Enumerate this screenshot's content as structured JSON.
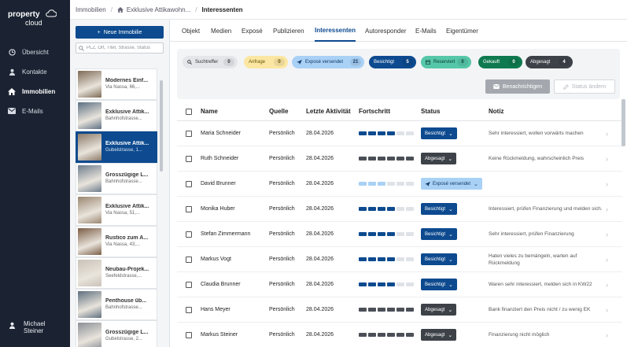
{
  "brand": {
    "line1": "property",
    "line2": "cloud"
  },
  "nav": {
    "items": [
      {
        "label": "Übersicht",
        "icon": "clock-icon"
      },
      {
        "label": "Kontakte",
        "icon": "person-icon"
      },
      {
        "label": "Immobilien",
        "icon": "house-icon"
      },
      {
        "label": "E-Mails",
        "icon": "envelope-icon"
      }
    ],
    "user": {
      "first": "Michael",
      "last": "Steiner",
      "icon": "person-icon"
    }
  },
  "breadcrumb": {
    "root": "Immobilien",
    "property": "Exklusive Attikawohn...",
    "current": "Interessenten"
  },
  "sidebar": {
    "new_button": "Neue Immobilie",
    "search_placeholder": "PLZ, Ort, Titel, Strasse, Status",
    "properties": [
      {
        "title": "Modernes Einf...",
        "address": "Via Nassa, 66,..."
      },
      {
        "title": "Exklusive Attik...",
        "address": "Bahnhofstrasse..."
      },
      {
        "title": "Exklusive Attik...",
        "address": "Gubelstrasse, 1..."
      },
      {
        "title": "Grosszügige L...",
        "address": "Bahnhofstrasse..."
      },
      {
        "title": "Exklusive Attik...",
        "address": "Via Nassa, 51,..."
      },
      {
        "title": "Rustico zum A...",
        "address": "Via Nassa, 43,..."
      },
      {
        "title": "Neubau-Projek...",
        "address": "Seefeldstrasse,..."
      },
      {
        "title": "Penthouse üb...",
        "address": "Bahnhofstrasse..."
      },
      {
        "title": "Grosszügige L...",
        "address": "Gubelstrasse, 2..."
      }
    ]
  },
  "tabs": [
    "Objekt",
    "Medien",
    "Exposé",
    "Publizieren",
    "Interessenten",
    "Autoresponder",
    "E-Mails",
    "Eigentümer"
  ],
  "filters": [
    {
      "label": "Suchtreffer",
      "count": "0",
      "bg": "#e4e6ea",
      "fg": "#333",
      "icon": "search-icon"
    },
    {
      "label": "Anfrage",
      "count": "0",
      "bg": "#fbe7a3",
      "fg": "#6b5200",
      "icon": ""
    },
    {
      "label": "Exposé versendet",
      "count": "21",
      "bg": "#a9d1f5",
      "fg": "#103a66",
      "icon": "send-icon"
    },
    {
      "label": "Besichtigt",
      "count": "5",
      "bg": "#0d4a8f",
      "fg": "#ffffff",
      "icon": ""
    },
    {
      "label": "Reserviert",
      "count": "0",
      "bg": "#56c7a9",
      "fg": "#0b3b2e",
      "icon": "calendar-icon"
    },
    {
      "label": "Gekauft",
      "count": "0",
      "bg": "#0f7a4f",
      "fg": "#ffffff",
      "icon": ""
    },
    {
      "label": "Abgesagt",
      "count": "4",
      "bg": "#3d4248",
      "fg": "#ffffff",
      "icon": ""
    }
  ],
  "actions": {
    "notify": "Benachrichtigen",
    "change_status": "Status ändern"
  },
  "columns": {
    "name": "Name",
    "source": "Quelle",
    "activity": "Letzte Aktivität",
    "progress": "Fortschritt",
    "status": "Status",
    "note": "Notiz"
  },
  "colors": {
    "besichtigt": "#0d4a8f",
    "abgesagt": "#3d4248",
    "versendet": "#a9d1f5"
  },
  "rows": [
    {
      "name": "Maria Schneider",
      "source": "Persönlich",
      "activity": "28.04.2026",
      "progress": 4,
      "progress_color": "#0d4a8f",
      "status": "Besichtigt",
      "status_type": "besichtigt",
      "note": "Sehr interessiert, wollen vorwärts machen"
    },
    {
      "name": "Ruth Schneider",
      "source": "Persönlich",
      "activity": "28.04.2026",
      "progress": 6,
      "progress_color": "#4b5058",
      "status": "Abgesagt",
      "status_type": "abgesagt",
      "note": "Keine Rückmeldung, wahrscheinlich Preis"
    },
    {
      "name": "David Brunner",
      "source": "Persönlich",
      "activity": "28.04.2026",
      "progress": 3,
      "progress_color": "#a9d1f5",
      "status": "Exposé versendet",
      "status_type": "versendet",
      "note": ""
    },
    {
      "name": "Monika Huber",
      "source": "Persönlich",
      "activity": "28.04.2026",
      "progress": 4,
      "progress_color": "#0d4a8f",
      "status": "Besichtigt",
      "status_type": "besichtigt",
      "note": "Interessiert, prüfen Finanzierung und melden sich."
    },
    {
      "name": "Stefan Zimmermann",
      "source": "Persönlich",
      "activity": "28.04.2026",
      "progress": 4,
      "progress_color": "#0d4a8f",
      "status": "Besichtigt",
      "status_type": "besichtigt",
      "note": "Sehr interessiert, prüfen Finanzierung"
    },
    {
      "name": "Markus Vogt",
      "source": "Persönlich",
      "activity": "28.04.2026",
      "progress": 4,
      "progress_color": "#0d4a8f",
      "status": "Besichtigt",
      "status_type": "besichtigt",
      "note": "Haten vieles zu bemängeln, warten auf Rückmeldung"
    },
    {
      "name": "Claudia Brunner",
      "source": "Persönlich",
      "activity": "28.04.2026",
      "progress": 4,
      "progress_color": "#0d4a8f",
      "status": "Besichtigt",
      "status_type": "besichtigt",
      "note": "Waren sehr interessiert, melden sich in KW22"
    },
    {
      "name": "Hans Meyer",
      "source": "Persönlich",
      "activity": "28.04.2026",
      "progress": 6,
      "progress_color": "#4b5058",
      "status": "Abgesagt",
      "status_type": "abgesagt",
      "note": "Bank finanziert den Preis nicht / zu wenig EK"
    },
    {
      "name": "Markus Steiner",
      "source": "Persönlich",
      "activity": "28.04.2026",
      "progress": 6,
      "progress_color": "#4b5058",
      "status": "Abgesagt",
      "status_type": "abgesagt",
      "note": "Finanzierung nicht möglich"
    }
  ]
}
